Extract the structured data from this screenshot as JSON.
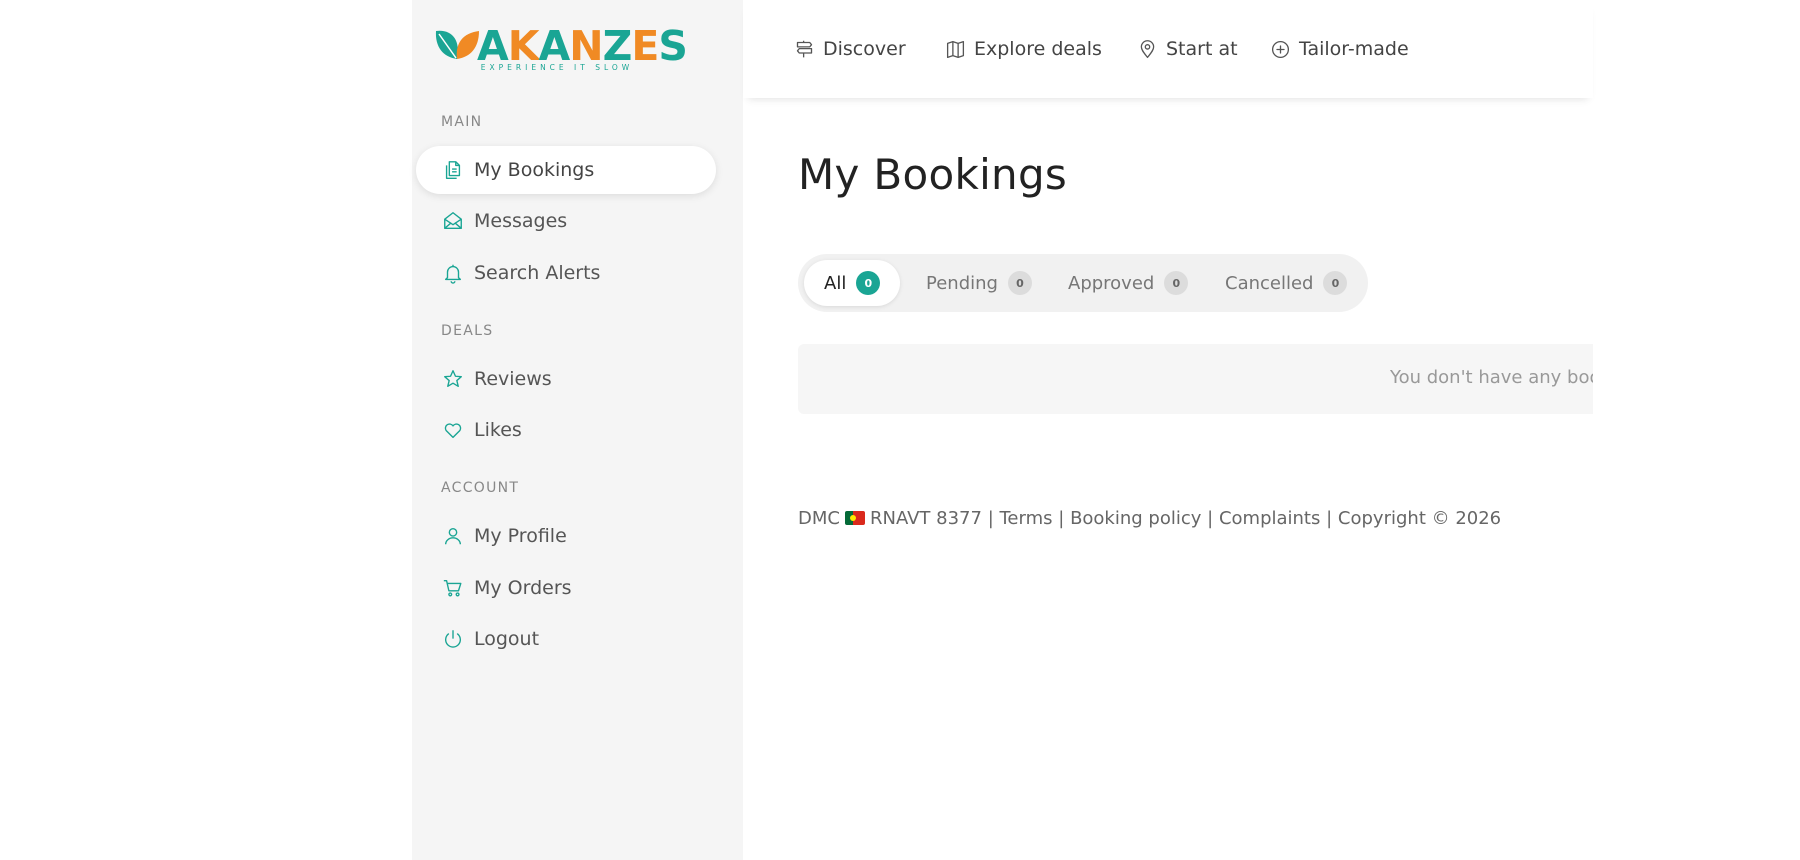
{
  "colors": {
    "accent": "#1aa594",
    "logo_orange": "#f08a24",
    "logo_teal": "#1aa594",
    "sidebar_bg": "#f5f5f5"
  },
  "logo": {
    "word": "AKANZES",
    "tagline": "EXPERIENCE IT SLOW"
  },
  "sidebar": {
    "sections": [
      {
        "title": "MAIN",
        "items": [
          {
            "label": "My Bookings",
            "icon": "documents-icon",
            "active": true
          },
          {
            "label": "Messages",
            "icon": "envelope-open-icon"
          },
          {
            "label": "Search Alerts",
            "icon": "bell-icon"
          }
        ]
      },
      {
        "title": "DEALS",
        "items": [
          {
            "label": "Reviews",
            "icon": "star-icon"
          },
          {
            "label": "Likes",
            "icon": "heart-icon"
          }
        ]
      },
      {
        "title": "ACCOUNT",
        "items": [
          {
            "label": "My Profile",
            "icon": "user-icon"
          },
          {
            "label": "My Orders",
            "icon": "cart-icon"
          },
          {
            "label": "Logout",
            "icon": "power-icon"
          }
        ]
      }
    ]
  },
  "topnav": {
    "items": [
      {
        "label": "Discover",
        "icon": "signpost-icon"
      },
      {
        "label": "Explore deals",
        "icon": "map-icon"
      },
      {
        "label": "Start at",
        "icon": "location-pin-icon"
      },
      {
        "label": "Tailor-made",
        "icon": "plus-circle-icon"
      }
    ]
  },
  "main": {
    "title": "My Bookings",
    "tabs": [
      {
        "label": "All",
        "count": "0",
        "active": true
      },
      {
        "label": "Pending",
        "count": "0"
      },
      {
        "label": "Approved",
        "count": "0"
      },
      {
        "label": "Cancelled",
        "count": "0"
      }
    ],
    "empty_message": "You don't have any bool"
  },
  "footer": {
    "dmc": "DMC",
    "flag_icon": "portugal-flag-icon",
    "rnavt": "RNAVT 8377",
    "separator": "|",
    "terms": "Terms",
    "booking_policy": "Booking policy",
    "complaints": "Complaints",
    "copyright": "Copyright © 2026"
  }
}
